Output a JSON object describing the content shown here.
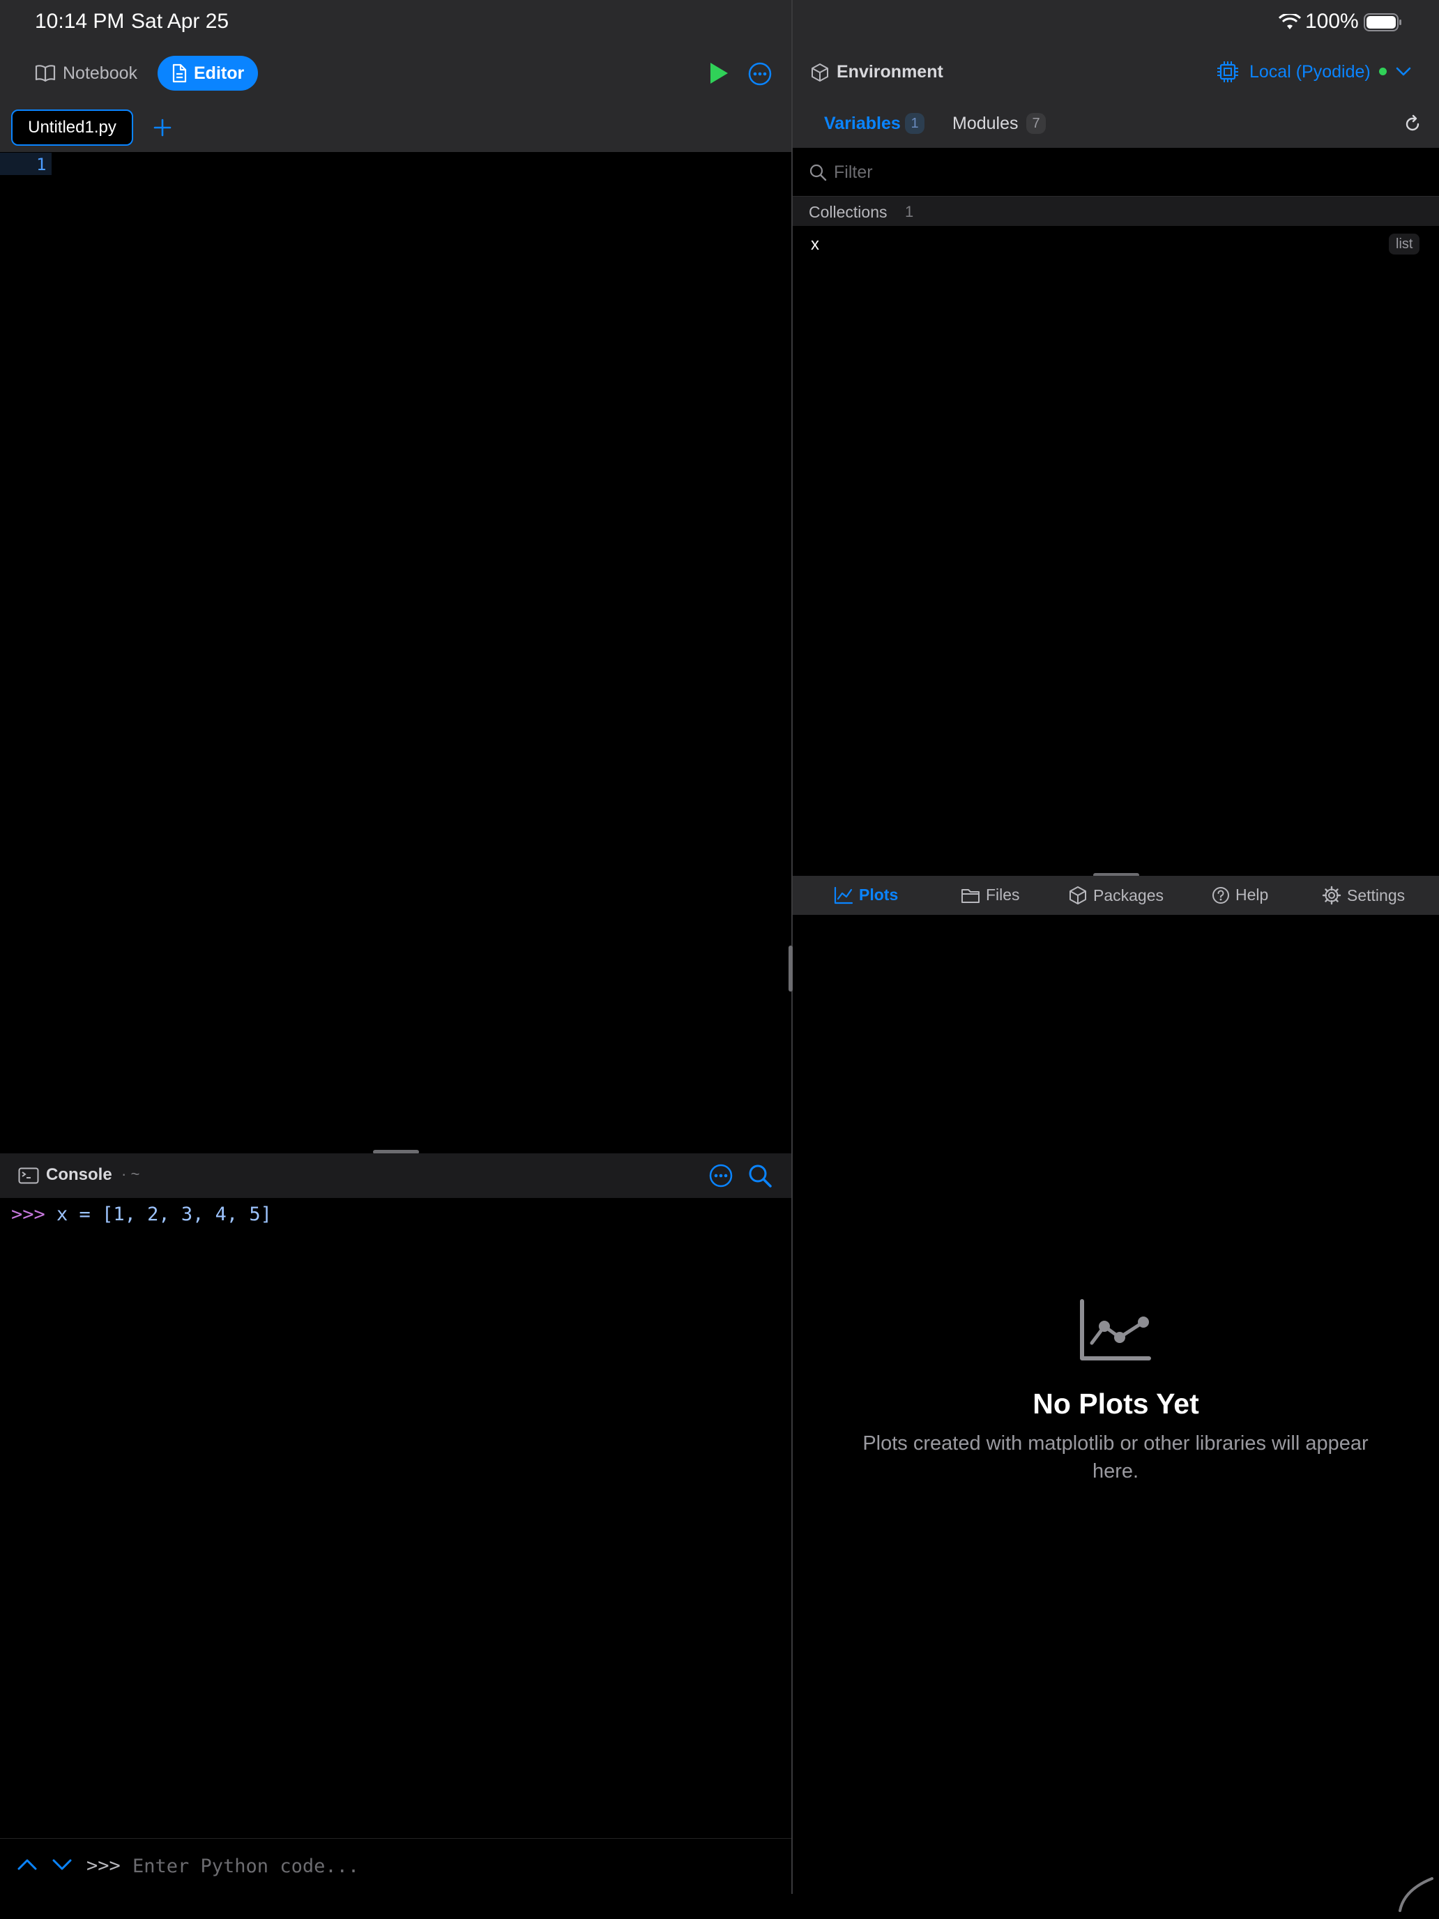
{
  "status_bar": {
    "time": "10:14 PM",
    "date": "Sat Apr 25",
    "battery": "100%"
  },
  "toolbar": {
    "notebook_label": "Notebook",
    "editor_label": "Editor"
  },
  "editor": {
    "file_tab": "Untitled1.py",
    "line_number": "1"
  },
  "console": {
    "title": "Console",
    "path": "· ~",
    "history": [
      {
        "prompt": ">>>",
        "code": "x = [1, 2, 3, 4, 5]"
      }
    ],
    "input_prompt": ">>>",
    "input_placeholder": "Enter Python code..."
  },
  "environment": {
    "title": "Environment",
    "runtime": "Local (Pyodide)",
    "tabs": [
      {
        "label": "Variables",
        "count": "1"
      },
      {
        "label": "Modules",
        "count": "7"
      }
    ],
    "filter_placeholder": "Filter",
    "group": {
      "label": "Collections",
      "count": "1"
    },
    "variables": [
      {
        "name": "x",
        "type": "list"
      }
    ]
  },
  "bottom_tabs": [
    "Plots",
    "Files",
    "Packages",
    "Help",
    "Settings"
  ],
  "plots": {
    "empty_title": "No Plots Yet",
    "empty_desc": "Plots created with matplotlib or other libraries will appear here."
  },
  "colors": {
    "accent": "#0a84ff",
    "run": "#30d158",
    "status_connected": "#30d158",
    "toolbar_bg": "#2a2a2c",
    "prompt": "#c678dd"
  }
}
